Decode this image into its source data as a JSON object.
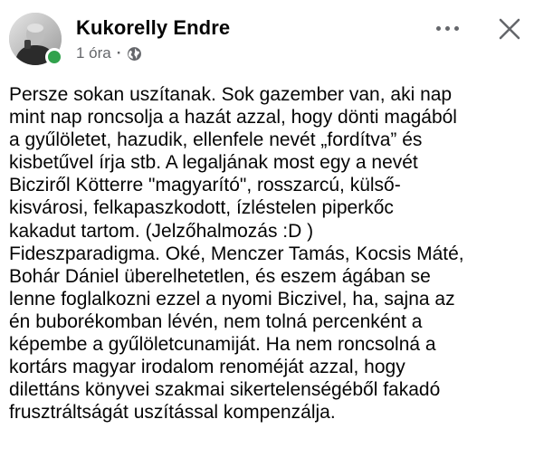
{
  "post": {
    "author": "Kukorelly Endre",
    "time": "1 óra",
    "separator": "·",
    "privacy_icon": "globe-icon",
    "more_icon": "more-horizontal-icon",
    "close_icon": "close-icon",
    "online_color": "#31a24c",
    "lines": [
      "Persze sokan uszítanak. Sok gazember van, aki nap",
      "mint nap roncsolja a hazát azzal, hogy dönti magából",
      "a gyűlöletet, hazudik, ellenfele nevét „fordítva” és",
      "kisbetűvel írja stb. A legaljának most egy a nevét",
      "Bicziről Kötterre \"magyarító\", rosszarcú, külső-",
      "kisvárosi, felkapaszkodott, ízléstelen piperkőc",
      "kakadut tartom. (Jelzőhalmozás :D )",
      "Fideszparadigma. Oké, Menczer Tamás, Kocsis Máté,",
      "Bohár Dániel überelhetetlen, és eszem ágában se",
      "lenne foglalkozni ezzel a nyomi Biczivel, ha, sajna az",
      "én buborékomban lévén, nem tolná percenként a",
      "képembe a gyűlöletcunamiját. Ha nem roncsolná a",
      "kortárs magyar irodalom renoméját azzal, hogy",
      "dilettáns könyvei szakmai sikertelenségéből fakadó",
      "frusztráltságát uszítással kompenzálja."
    ]
  }
}
